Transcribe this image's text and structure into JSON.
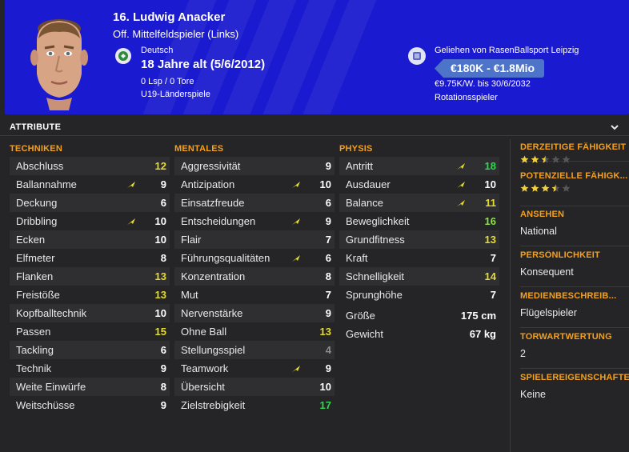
{
  "header": {
    "name": "16. Ludwig Anacker",
    "position": "Off. Mittelfeldspieler (Links)",
    "nation": "Deutsch",
    "age": "18 Jahre alt (5/6/2012)",
    "stats": "0 Lsp / 0 Tore",
    "caps": "U19-Länderspiele",
    "loan": "Geliehen von RasenBallsport Leipzig",
    "value": "€180K - €1.8Mio",
    "wage": "€9.75K/W. bis 30/6/2032",
    "role": "Rotationsspieler",
    "colors": {
      "banner": "#1a1ad0",
      "value_pill": "#4d74c8"
    }
  },
  "attributes": {
    "title": "ATTRIBUTE",
    "technik": {
      "title": "TECHNIKEN",
      "rows": [
        {
          "label": "Abschluss",
          "value": "12",
          "color": "yellow",
          "arrow": false
        },
        {
          "label": "Ballannahme",
          "value": "9",
          "color": "white",
          "arrow": true
        },
        {
          "label": "Deckung",
          "value": "6",
          "color": "white",
          "arrow": false
        },
        {
          "label": "Dribbling",
          "value": "10",
          "color": "white",
          "arrow": true
        },
        {
          "label": "Ecken",
          "value": "10",
          "color": "white",
          "arrow": false
        },
        {
          "label": "Elfmeter",
          "value": "8",
          "color": "white",
          "arrow": false
        },
        {
          "label": "Flanken",
          "value": "13",
          "color": "yellow",
          "arrow": false
        },
        {
          "label": "Freistöße",
          "value": "13",
          "color": "yellow",
          "arrow": false
        },
        {
          "label": "Kopfballtechnik",
          "value": "10",
          "color": "white",
          "arrow": false
        },
        {
          "label": "Passen",
          "value": "15",
          "color": "yellow",
          "arrow": false
        },
        {
          "label": "Tackling",
          "value": "6",
          "color": "white",
          "arrow": false
        },
        {
          "label": "Technik",
          "value": "9",
          "color": "white",
          "arrow": false
        },
        {
          "label": "Weite Einwürfe",
          "value": "8",
          "color": "white",
          "arrow": false
        },
        {
          "label": "Weitschüsse",
          "value": "9",
          "color": "white",
          "arrow": false
        }
      ]
    },
    "mental": {
      "title": "MENTALES",
      "rows": [
        {
          "label": "Aggressivität",
          "value": "9",
          "color": "white",
          "arrow": false
        },
        {
          "label": "Antizipation",
          "value": "10",
          "color": "white",
          "arrow": true
        },
        {
          "label": "Einsatzfreude",
          "value": "6",
          "color": "white",
          "arrow": false
        },
        {
          "label": "Entscheidungen",
          "value": "9",
          "color": "white",
          "arrow": true
        },
        {
          "label": "Flair",
          "value": "7",
          "color": "white",
          "arrow": false
        },
        {
          "label": "Führungsqualitäten",
          "value": "6",
          "color": "white",
          "arrow": true
        },
        {
          "label": "Konzentration",
          "value": "8",
          "color": "white",
          "arrow": false
        },
        {
          "label": "Mut",
          "value": "7",
          "color": "white",
          "arrow": false
        },
        {
          "label": "Nervenstärke",
          "value": "9",
          "color": "white",
          "arrow": false
        },
        {
          "label": "Ohne Ball",
          "value": "13",
          "color": "yellow",
          "arrow": false
        },
        {
          "label": "Stellungsspiel",
          "value": "4",
          "color": "grey",
          "arrow": false
        },
        {
          "label": "Teamwork",
          "value": "9",
          "color": "white",
          "arrow": true
        },
        {
          "label": "Übersicht",
          "value": "10",
          "color": "white",
          "arrow": false
        },
        {
          "label": "Zielstrebigkeit",
          "value": "17",
          "color": "green",
          "arrow": false
        }
      ]
    },
    "physis": {
      "title": "PHYSIS",
      "rows": [
        {
          "label": "Antritt",
          "value": "18",
          "color": "green",
          "arrow": true
        },
        {
          "label": "Ausdauer",
          "value": "10",
          "color": "white",
          "arrow": true
        },
        {
          "label": "Balance",
          "value": "11",
          "color": "yellow",
          "arrow": true
        },
        {
          "label": "Beweglichkeit",
          "value": "16",
          "color": "lgreen",
          "arrow": false
        },
        {
          "label": "Grundfitness",
          "value": "13",
          "color": "yellow",
          "arrow": false
        },
        {
          "label": "Kraft",
          "value": "7",
          "color": "white",
          "arrow": false
        },
        {
          "label": "Schnelligkeit",
          "value": "14",
          "color": "yellow",
          "arrow": false
        },
        {
          "label": "Sprunghöhe",
          "value": "7",
          "color": "white",
          "arrow": false
        }
      ],
      "height_label": "Größe",
      "height_value": "175 cm",
      "weight_label": "Gewicht",
      "weight_value": "67 kg"
    }
  },
  "side": {
    "current_ability": {
      "label": "DERZEITIGE FÄHIGKEIT",
      "stars": 2.5
    },
    "potential_ability": {
      "label": "POTENZIELLE FÄHIGK...",
      "stars": 3.5
    },
    "reputation": {
      "label": "ANSEHEN",
      "value": "National"
    },
    "personality": {
      "label": "PERSÖNLICHKEIT",
      "value": "Konsequent"
    },
    "media": {
      "label": "MEDIENBESCHREIB...",
      "value": "Flügelspieler"
    },
    "keeper_rating": {
      "label": "TORWARTWERTUNG",
      "value": "2"
    },
    "traits": {
      "label": "SPIELEREIGENSCHAFTEN",
      "value": "Keine"
    }
  },
  "icons": {
    "collapse": "chevron-down-icon",
    "nation": "flag-icon",
    "club": "club-crest-icon",
    "trend": "arrow-up-icon",
    "ability": "star-icon"
  }
}
